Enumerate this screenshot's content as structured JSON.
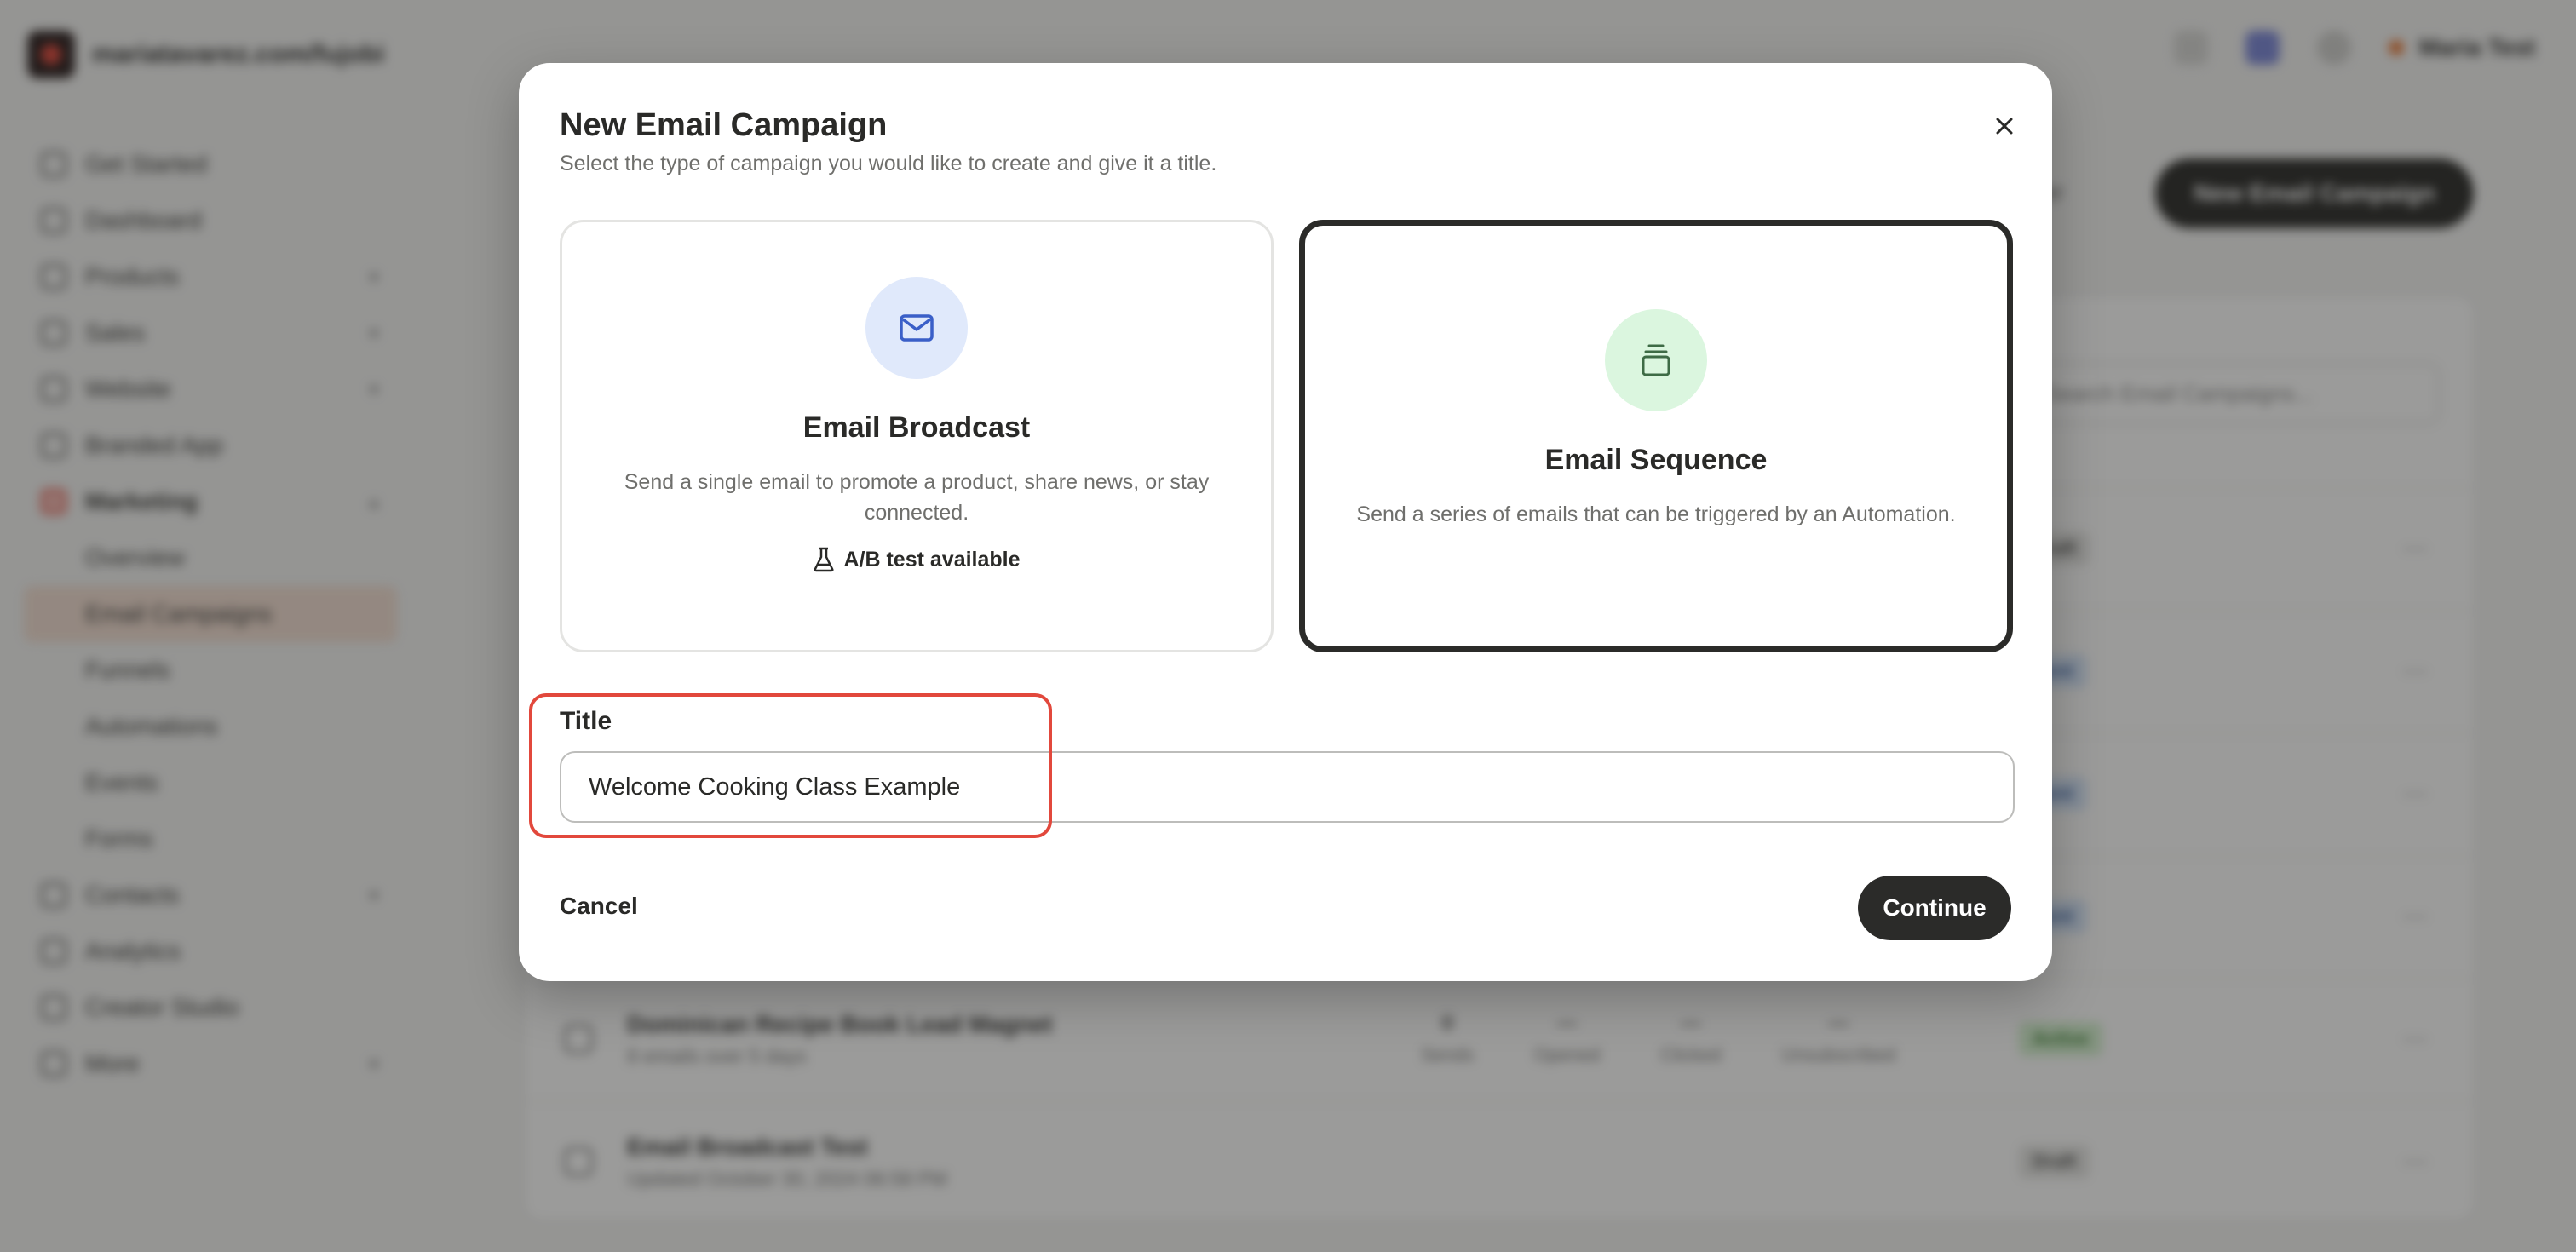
{
  "app": {
    "url": "mariatavarez.com/fujobi",
    "user_name": "Maria Test",
    "new_campaign_button": "New Email Campaign",
    "page_secondary": "Filter",
    "search_placeholder": "Search Email Campaigns..."
  },
  "sidebar": {
    "items": [
      {
        "label": "Get Started"
      },
      {
        "label": "Dashboard"
      },
      {
        "label": "Products"
      },
      {
        "label": "Sales"
      },
      {
        "label": "Website"
      },
      {
        "label": "Branded App"
      },
      {
        "label": "Marketing"
      },
      {
        "label": "Overview"
      },
      {
        "label": "Email Campaigns"
      },
      {
        "label": "Funnels"
      },
      {
        "label": "Automations"
      },
      {
        "label": "Events"
      },
      {
        "label": "Forms"
      },
      {
        "label": "Contacts"
      },
      {
        "label": "Analytics"
      },
      {
        "label": "Creator Studio"
      },
      {
        "label": "More"
      }
    ]
  },
  "campaign_rows": [
    {
      "title": "",
      "subtitle": "",
      "status": "Draft"
    },
    {
      "title": "",
      "subtitle": "",
      "status": "Sent"
    },
    {
      "title": "",
      "subtitle": "",
      "status": "Sent"
    },
    {
      "title": "",
      "subtitle": "",
      "status": "Sent"
    },
    {
      "title": "Dominican Recipe Book Lead Magnet",
      "subtitle": "8 emails over 5 days",
      "status": "Active",
      "stats": [
        {
          "value": "0",
          "label": "Sends"
        },
        {
          "value": "—",
          "label": "Opened"
        },
        {
          "value": "—",
          "label": "Clicked"
        },
        {
          "value": "—",
          "label": "Unsubscribed"
        }
      ]
    },
    {
      "title": "Email Broadcast Test",
      "subtitle": "Updated October 30, 2024 06:58 PM",
      "status": "Draft"
    }
  ],
  "modal": {
    "title": "New Email Campaign",
    "subtitle": "Select the type of campaign you would like to create and give it a title.",
    "options": {
      "broadcast": {
        "title": "Email Broadcast",
        "description": "Send a single email to promote a product, share news, or stay connected.",
        "ab_test": "A/B test available",
        "icon": "mail-icon"
      },
      "sequence": {
        "title": "Email Sequence",
        "description": "Send a series of emails that can be triggered by an Automation.",
        "icon": "stack-icon",
        "selected": true
      }
    },
    "title_label": "Title",
    "title_value": "Welcome Cooking Class Example",
    "cancel_label": "Cancel",
    "continue_label": "Continue"
  },
  "colors": {
    "accent_dark": "#2b2b29",
    "highlight_red": "#e2483c",
    "mail_icon_bg": "#e0e9fb",
    "mail_icon_fg": "#3a5fc8",
    "sequence_icon_bg": "#dbf6df",
    "sequence_icon_fg": "#3d6b45"
  }
}
